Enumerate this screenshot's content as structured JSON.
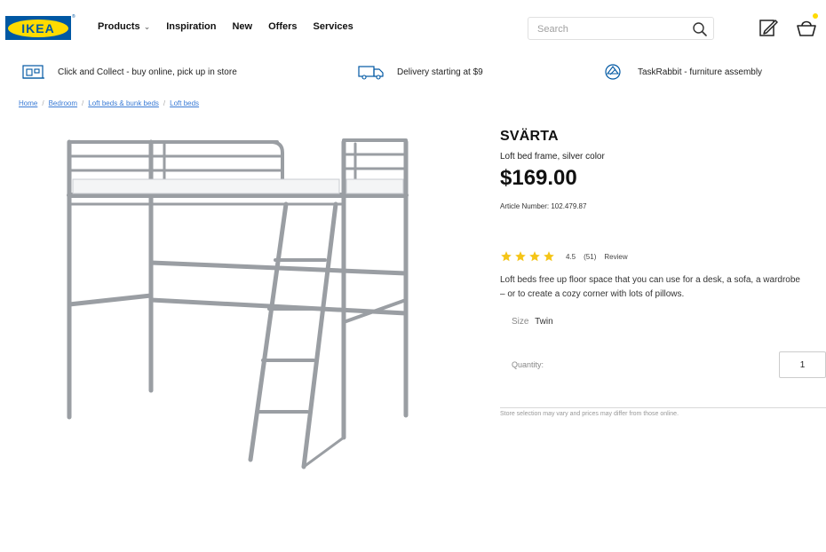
{
  "brand": {
    "logo_text": "IKEA",
    "reg_mark": "®",
    "blue": "#0058a3",
    "yellow": "#ffdb00"
  },
  "nav": {
    "items": [
      {
        "label": "Products",
        "has_dropdown": true
      },
      {
        "label": "Inspiration"
      },
      {
        "label": "New"
      },
      {
        "label": "Offers"
      },
      {
        "label": "Services"
      }
    ]
  },
  "search": {
    "placeholder": "Search",
    "icon": "search-icon"
  },
  "header_icons": {
    "edit": "edit-icon",
    "basket": "basket-icon"
  },
  "services": [
    {
      "icon": "click-collect-icon",
      "label": "Click and Collect - buy online, pick up in store"
    },
    {
      "icon": "delivery-truck-icon",
      "label": "Delivery starting at $9"
    },
    {
      "icon": "taskrabbit-icon",
      "label": "TaskRabbit - furniture assembly"
    }
  ],
  "breadcrumb": [
    "Home",
    "Bedroom",
    "Loft beds & bunk beds",
    "Loft beds"
  ],
  "product": {
    "name": "SVÄRTA",
    "description": "Loft bed frame, silver color",
    "price": "$169.00",
    "article": "Article Number: 102.479.87",
    "rating_value": "4.5",
    "rating_stars": 4,
    "review_count": "(51)",
    "review_label": "Review",
    "blurb": "Loft beds free up floor space that you can use for a desk, a sofa, a wardrobe – or to create a cozy corner with lots of pillows.",
    "size_label": "Size",
    "size_value": "Twin",
    "quantity_label": "Quantity:",
    "quantity_value": "1",
    "notice": "Store selection may vary and prices may differ from those online."
  },
  "colors": {
    "star": "#f5c518",
    "link": "#3a7bd5",
    "frame": "#9a9ea3"
  }
}
